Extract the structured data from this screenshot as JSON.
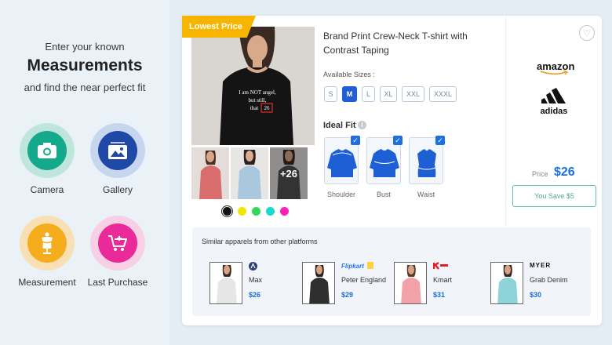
{
  "left_panel": {
    "intro_line1": "Enter your known",
    "intro_line2": "Measurements",
    "intro_line3": "and find the near perfect fit",
    "options": [
      {
        "label": "Camera",
        "icon": "camera-icon",
        "ring": "#bfe6dc",
        "core": "#14a98b"
      },
      {
        "label": "Gallery",
        "icon": "gallery-icon",
        "ring": "#c7d6ef",
        "core": "#1f49a6"
      },
      {
        "label": "Measurement",
        "icon": "measurement-mannequin-icon",
        "ring": "#f9e0b4",
        "core": "#f6ad1d"
      },
      {
        "label": "Last Purchase",
        "icon": "cart-icon",
        "ring": "#f7d0e6",
        "core": "#ea2a99"
      }
    ]
  },
  "product": {
    "badge": "Lowest Price",
    "title": "Brand Print Crew-Neck T-shirt with Contrast Taping",
    "tee_print": "I am NOT angel, but still, that 26",
    "more_images": "+26",
    "color_swatches": [
      "#111111",
      "#f2e600",
      "#30d95a",
      "#18d8d0",
      "#ff1fb8"
    ],
    "selected_color_index": 0,
    "sizes_label": "Available Sizes :",
    "sizes": [
      "S",
      "M",
      "L",
      "XL",
      "XXL",
      "XXXL"
    ],
    "selected_size": "M",
    "fit_label": "Ideal Fit",
    "fits": [
      "Shoulder",
      "Bust",
      "Waist"
    ],
    "accent_color": "#1f5fd6"
  },
  "price_panel": {
    "brands": [
      "amazon",
      "adidas"
    ],
    "price_label": "Price",
    "price": "$26",
    "save_label": "You Save $5"
  },
  "similar": {
    "title": "Similar apparels from other platforms",
    "items": [
      {
        "platform": "",
        "name": "Max",
        "price": "$26",
        "shirt": "#e6e6e6"
      },
      {
        "platform": "Flipkart",
        "name": "Peter England",
        "price": "$29",
        "shirt": "#2f2f2f"
      },
      {
        "platform": "",
        "name": "Kmart",
        "price": "$31",
        "shirt": "#f2a2a8"
      },
      {
        "platform": "MYER",
        "name": "Grab Denim",
        "price": "$30",
        "shirt": "#8fd3da"
      }
    ]
  }
}
